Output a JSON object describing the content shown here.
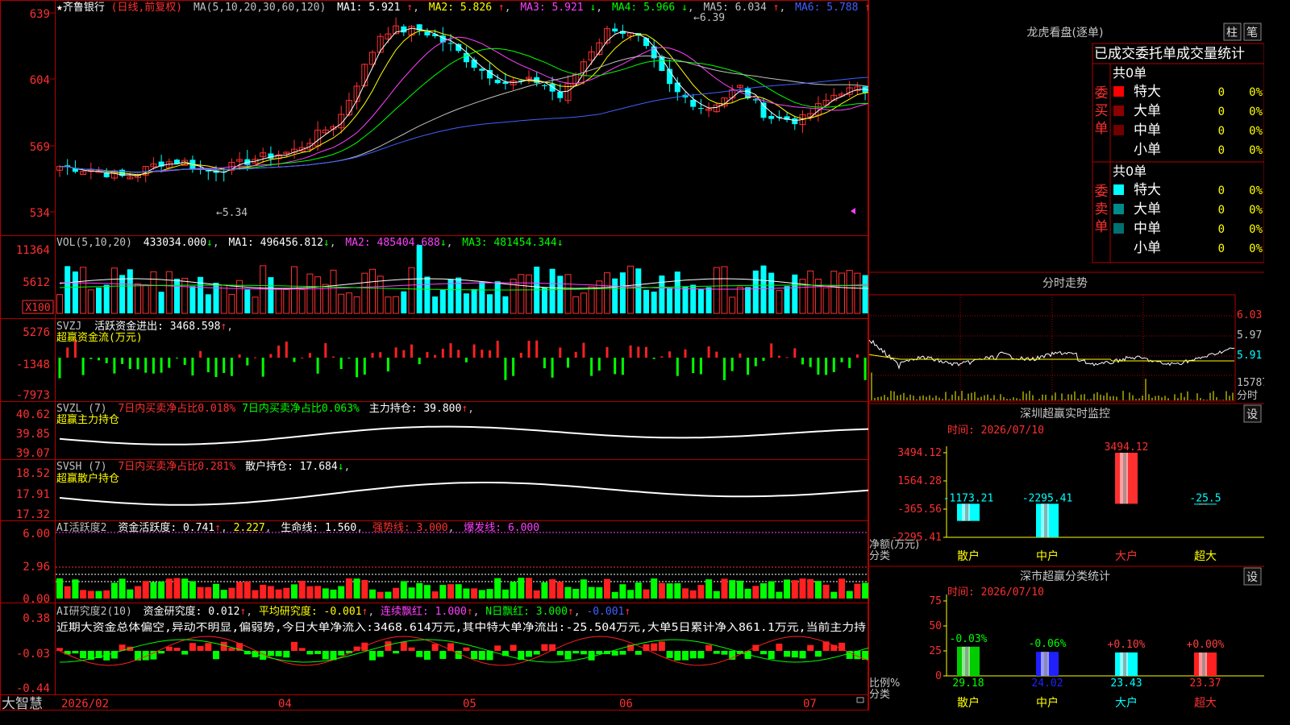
{
  "app": {
    "brand": "大智慧"
  },
  "stock": {
    "name": "★齐鲁银行",
    "mode": "(日线,前复权)"
  },
  "price_panel": {
    "ma_label": "MA(5,10,20,30,60,120)",
    "ma": [
      {
        "text": "MA1: 5.921",
        "color": "#ffffff"
      },
      {
        "text": "MA2: 5.826",
        "color": "#ffff00"
      },
      {
        "text": "MA3: 5.921",
        "color": "#ff40ff"
      },
      {
        "text": "MA4: 5.966",
        "color": "#00ff00"
      },
      {
        "text": "MA5: 6.034",
        "color": "#c0c0c0"
      },
      {
        "text": "MA6: 5.788",
        "color": "#4060ff"
      }
    ],
    "y_ticks": [
      "639",
      "604",
      "569",
      "534"
    ],
    "high_label": "6.39",
    "low_label": "5.34"
  },
  "vol_panel": {
    "label": "VOL(5,10,20)",
    "value": "433034.000",
    "ma": [
      {
        "text": "MA1: 496456.812",
        "color": "#ffffff"
      },
      {
        "text": "MA2: 485404.688",
        "color": "#ff40ff"
      },
      {
        "text": "MA3: 481454.344",
        "color": "#00ff00"
      }
    ],
    "y_ticks": [
      "11364",
      "5612"
    ],
    "unit": "X100"
  },
  "svzj_panel": {
    "label": "SVZJ",
    "desc": "活跃资金进出: 3468.598",
    "sub": "超赢资金流(万元)",
    "y_ticks": [
      "5276",
      "-1348",
      "-7973"
    ]
  },
  "svzl_panel": {
    "label": "SVZL (7)",
    "desc1": "7日内买卖净占比0.018%",
    "desc2": "7日内买卖净占比0.063%",
    "desc3": "主力持仓: 39.800",
    "sub": "超赢主力持仓",
    "y_ticks": [
      "40.62",
      "39.85",
      "39.07"
    ]
  },
  "svsh_panel": {
    "label": "SVSH (7)",
    "desc1": "7日内买卖净占比0.281%",
    "desc2": "散户持仓: 17.684",
    "sub": "超赢散户持仓",
    "y_ticks": [
      "18.52",
      "17.91",
      "17.32"
    ]
  },
  "ai1_panel": {
    "label": "AI活跃度2",
    "desc1": "资金活跃度: 0.741",
    "desc2": "2.227",
    "desc3": "生命线: 1.560",
    "desc4": "强势线: 3.000",
    "desc5": "爆发线: 6.000",
    "y_ticks": [
      "6.00",
      "2.96",
      "0.00"
    ]
  },
  "ai2_panel": {
    "label": "AI研究度2(10)",
    "desc1": "资金研究度: 0.012",
    "desc2": "平均研究度: -0.001",
    "desc3": "连续飘红: 1.000",
    "desc4": "N日飘红: 3.000",
    "desc5": "-0.001",
    "summary": "近期大资金总体偏空,异动不明显,偏弱势,今日大单净流入:3468.614万元,其中特大单净流出:-25.504万元,大单5日累计净入861.1万元,当前主力持",
    "y_ticks": [
      "0.38",
      "-0.03",
      "-0.44"
    ]
  },
  "x_axis": [
    "2026/02",
    "04",
    "05",
    "06",
    "07"
  ],
  "longhu": {
    "title": "龙虎看盘(逐单)",
    "btn1": "柱",
    "btn2": "笔",
    "subtitle": "已成交委托单成交量统计",
    "buy": {
      "side": [
        "委",
        "买",
        "单"
      ],
      "total": "共0单",
      "rows": [
        {
          "label": "特大",
          "count": "0",
          "pct": "0%",
          "color": "#ff0000"
        },
        {
          "label": "大单",
          "count": "0",
          "pct": "0%",
          "color": "#8b0000"
        },
        {
          "label": "中单",
          "count": "0",
          "pct": "0%",
          "color": "#700000"
        },
        {
          "label": "小单",
          "count": "0",
          "pct": "0%",
          "color": ""
        }
      ]
    },
    "sell": {
      "side": [
        "委",
        "卖",
        "单"
      ],
      "total": "共0单",
      "rows": [
        {
          "label": "特大",
          "count": "0",
          "pct": "0%",
          "color": "#00ffff"
        },
        {
          "label": "大单",
          "count": "0",
          "pct": "0%",
          "color": "#008b8b"
        },
        {
          "label": "中单",
          "count": "0",
          "pct": "0%",
          "color": "#007070"
        },
        {
          "label": "小单",
          "count": "0",
          "pct": "0%",
          "color": ""
        }
      ]
    }
  },
  "fenshi": {
    "title": "分时走势",
    "y_ticks": [
      "6.03",
      "5.97",
      "5.91"
    ],
    "vol_label": "15787",
    "footer": "分时"
  },
  "monitor": {
    "title": "深圳超赢实时监控",
    "btn": "设",
    "time": "时间: 2026/07/10",
    "y_axis_label": "净额(万元)",
    "cat_axis_label": "分类",
    "y_ticks": [
      "3494.12",
      "1564.28",
      "-365.56",
      "-2295.41"
    ]
  },
  "classify": {
    "title": "深市超赢分类统计",
    "btn": "设",
    "time": "时间: 2026/07/10",
    "y_axis_label": "比例%",
    "cat_axis_label": "分类",
    "y_ticks": [
      "75",
      "50",
      "25",
      "0"
    ]
  },
  "chart_data": [
    {
      "type": "bar",
      "title": "深圳超赢实时监控",
      "ylabel": "净额(万元)",
      "xlabel": "分类",
      "categories": [
        "散户",
        "中户",
        "大户",
        "超大"
      ],
      "values": [
        -1173.21,
        -2295.41,
        3494.12,
        -25.5
      ],
      "value_labels": [
        "-1173.21",
        "-2295.41",
        "3494.12",
        "-25.5"
      ],
      "ylim": [
        -2295.41,
        3494.12
      ],
      "bar_colors": [
        "#00ffff",
        "#00ffff",
        "#ff3030",
        "#00ffff"
      ]
    },
    {
      "type": "bar",
      "title": "深市超赢分类统计",
      "ylabel": "比例%",
      "xlabel": "分类",
      "categories": [
        "散户",
        "中户",
        "大户",
        "超大"
      ],
      "values": [
        29.18,
        24.02,
        23.43,
        23.37
      ],
      "value_labels": [
        "29.18",
        "24.02",
        "23.43",
        "23.37"
      ],
      "change_labels": [
        "-0.03%",
        "-0.06%",
        "+0.10%",
        "+0.00%"
      ],
      "ylim": [
        0,
        75
      ],
      "bar_colors": [
        "#00cc00",
        "#2020ff",
        "#00ffff",
        "#ff2020"
      ],
      "change_colors": [
        "#00ff00",
        "#00ff00",
        "#ff4040",
        "#ff4040"
      ]
    }
  ]
}
